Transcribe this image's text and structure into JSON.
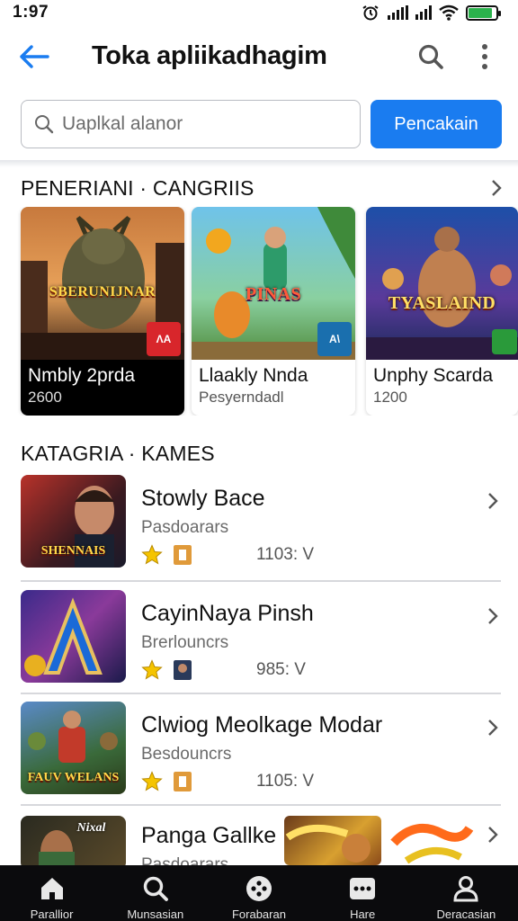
{
  "status_bar": {
    "time": "1:97"
  },
  "app_bar": {
    "title": "Toka apliikadhagim"
  },
  "search": {
    "placeholder": "Uaplkal alanor",
    "button_label": "Pencakain"
  },
  "featured_section": {
    "title": "PENERIANI · CANGRIIS",
    "cards": [
      {
        "art_text": "SBERUNIJNAR",
        "badge_text": "ΛA",
        "name": "Nmbly 2prda",
        "meta": "2600"
      },
      {
        "art_text": "PINAS",
        "badge_text": "A\\",
        "name": "Llaakly Nnda",
        "meta": "Pesyerndadl"
      },
      {
        "art_text": "TYASLAIND",
        "badge_text": "",
        "name": "Unphy Scarda",
        "meta": "1200"
      }
    ]
  },
  "category_section": {
    "title": "KATAGRIA · KAMES",
    "items": [
      {
        "thumb_text": "SHENNAIS",
        "title": "Stowly Bace",
        "subtitle": "Pasdoarars",
        "value": "1103: V"
      },
      {
        "thumb_text": "A",
        "title": "CayinNaya Pinsh",
        "subtitle": "Brerlouncrs",
        "value": "985: V"
      },
      {
        "thumb_text": "FAUV WELANS",
        "title": "Clwiog Meolkage Modar",
        "subtitle": "Besdouncrs",
        "value": "1105: V"
      },
      {
        "thumb_text": "Nixal",
        "title": "Panga Gallke",
        "subtitle": "Pasdoarars"
      }
    ]
  },
  "bottom_nav": [
    {
      "label": "Parallior",
      "icon": "home-icon"
    },
    {
      "label": "Munsasian",
      "icon": "search-icon"
    },
    {
      "label": "Forabaran",
      "icon": "gamepad-icon"
    },
    {
      "label": "Hare",
      "icon": "chat-icon"
    },
    {
      "label": "Deracasian",
      "icon": "profile-icon"
    }
  ],
  "colors": {
    "accent": "#1a7cf0",
    "nav_background": "#0b0b0d",
    "star": "#f5c400"
  }
}
